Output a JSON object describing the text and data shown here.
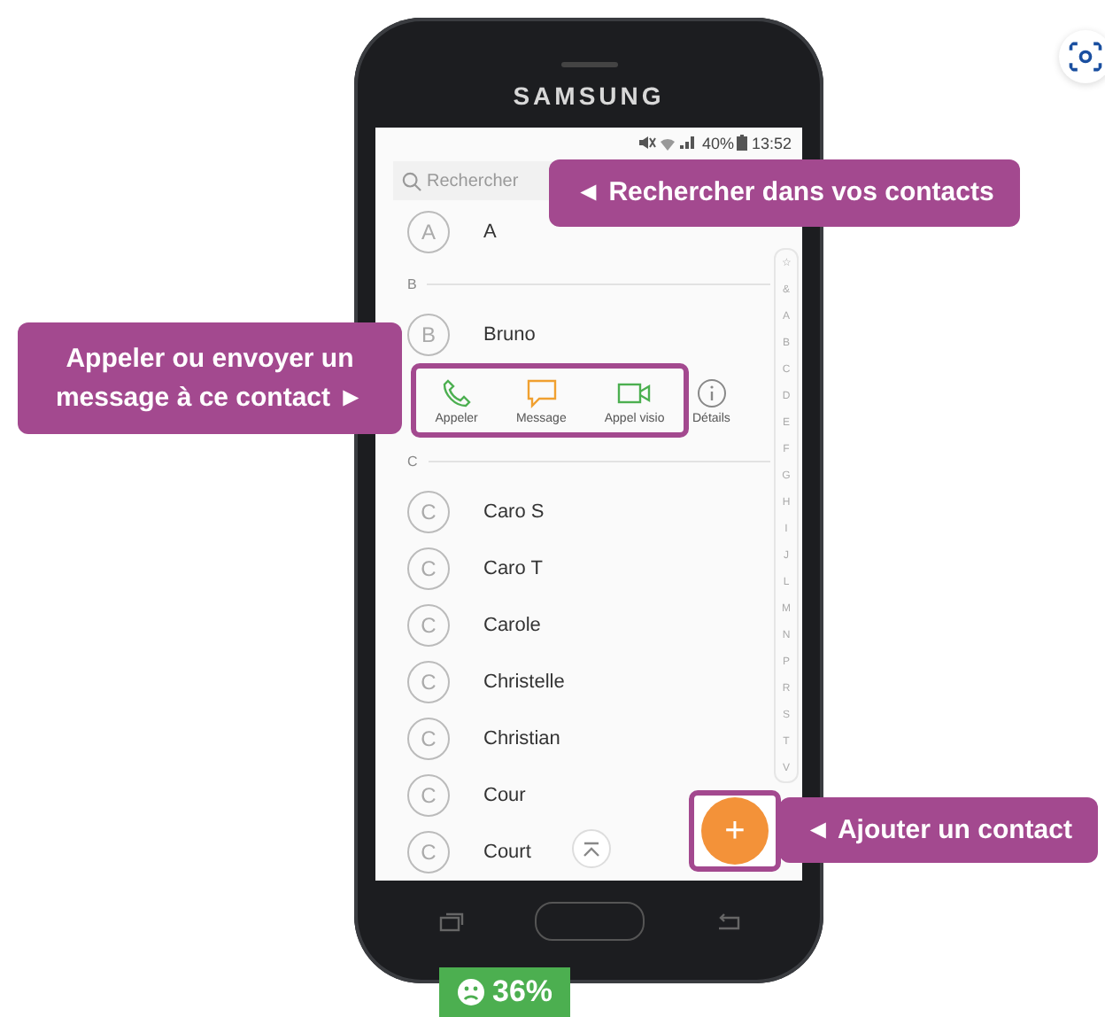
{
  "phone": {
    "brand": "SAMSUNG",
    "status_bar": {
      "battery": "40%",
      "time": "13:52"
    },
    "search": {
      "placeholder": "Rechercher"
    },
    "contacts": [
      {
        "kind": "contact",
        "initial": "A",
        "name": "A"
      },
      {
        "kind": "header",
        "label": "B"
      },
      {
        "kind": "contact",
        "initial": "B",
        "name": "Bruno"
      },
      {
        "kind": "actions",
        "highlighted": [
          {
            "kind": "call",
            "label": "Appeler"
          },
          {
            "kind": "message",
            "label": "Message"
          },
          {
            "kind": "video",
            "label": "Appel visio"
          }
        ],
        "others": [
          {
            "kind": "info",
            "label": "Détails"
          }
        ]
      },
      {
        "kind": "header",
        "label": "C"
      },
      {
        "kind": "contact",
        "initial": "C",
        "name": "Caro S"
      },
      {
        "kind": "contact",
        "initial": "C",
        "name": "Caro T"
      },
      {
        "kind": "contact",
        "initial": "C",
        "name": "Carole"
      },
      {
        "kind": "contact",
        "initial": "C",
        "name": "Christelle"
      },
      {
        "kind": "contact",
        "initial": "C",
        "name": "Christian"
      },
      {
        "kind": "contact",
        "initial": "C",
        "name": "Cour"
      },
      {
        "kind": "contact",
        "initial": "C",
        "name": "Court"
      }
    ],
    "index": [
      "☆",
      "&",
      "A",
      "B",
      "C",
      "D",
      "E",
      "F",
      "G",
      "H",
      "I",
      "J",
      "L",
      "M",
      "N",
      "P",
      "R",
      "S",
      "T",
      "V"
    ],
    "add_button": {
      "label": "+"
    }
  },
  "callouts": [
    {
      "kind": "search",
      "text": "◄ Rechercher dans vos contacts"
    },
    {
      "kind": "actions",
      "text": "Appeler ou envoyer un message à ce contact ►"
    },
    {
      "kind": "add",
      "text": "◄ Ajouter un contact"
    }
  ],
  "score_badge": {
    "text": "36%"
  }
}
